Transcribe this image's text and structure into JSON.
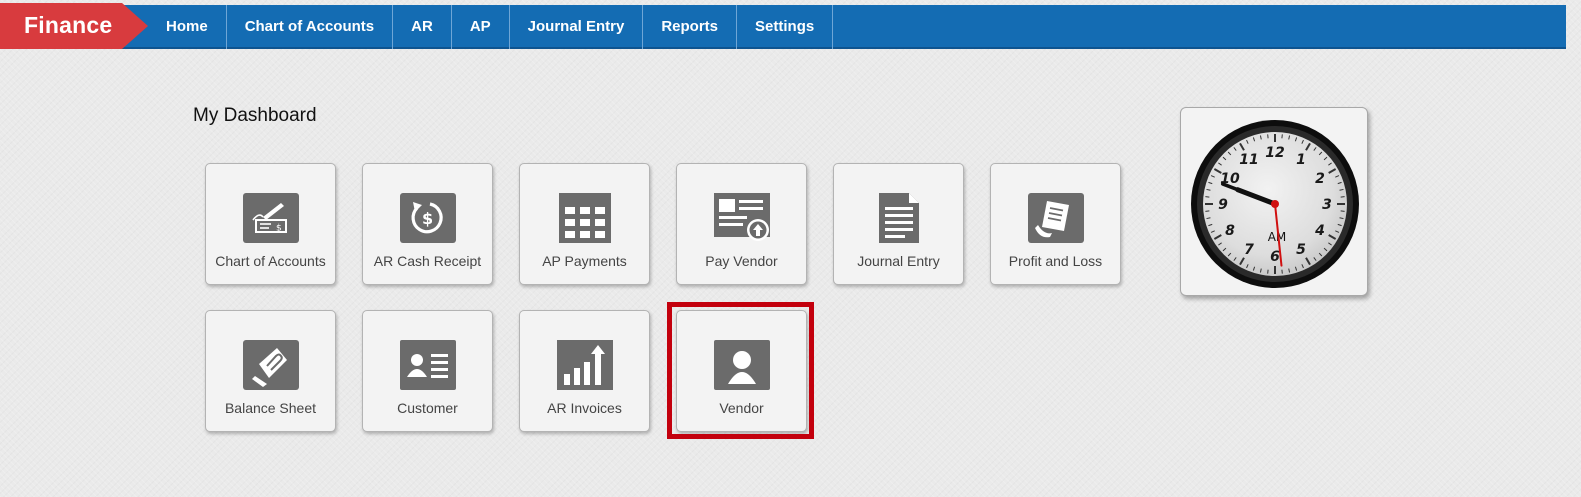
{
  "brand": "Finance",
  "nav": {
    "items": [
      {
        "label": "Home"
      },
      {
        "label": "Chart of Accounts"
      },
      {
        "label": "AR"
      },
      {
        "label": "AP"
      },
      {
        "label": "Journal Entry"
      },
      {
        "label": "Reports"
      },
      {
        "label": "Settings"
      }
    ]
  },
  "dashboard": {
    "title": "My Dashboard",
    "tiles": [
      {
        "label": "Chart of Accounts",
        "icon": "check-icon"
      },
      {
        "label": "AR Cash Receipt",
        "icon": "cash-refund-icon"
      },
      {
        "label": "AP Payments",
        "icon": "calculator-grid-icon"
      },
      {
        "label": "Pay Vendor",
        "icon": "pay-upload-icon"
      },
      {
        "label": "Journal Entry",
        "icon": "document-icon"
      },
      {
        "label": "Profit and Loss",
        "icon": "receipt-icon"
      },
      {
        "label": "Balance Sheet",
        "icon": "paper-clip-icon"
      },
      {
        "label": "Customer",
        "icon": "contact-card-icon"
      },
      {
        "label": "AR Invoices",
        "icon": "bar-growth-icon"
      },
      {
        "label": "Vendor",
        "icon": "person-icon"
      }
    ],
    "highlighted_tile": "Vendor"
  },
  "clock": {
    "period": "AM",
    "numerals": [
      "12",
      "1",
      "2",
      "3",
      "4",
      "5",
      "6",
      "7",
      "8",
      "9",
      "10",
      "11"
    ],
    "hands": {
      "hour": 9.7,
      "minute": 48.5,
      "second": 29
    },
    "colors": {
      "second_hand": "#d01010",
      "bezel": "#111111",
      "face": "#e4e4e4"
    }
  },
  "colors": {
    "nav_bg": "#146cb3",
    "brand_bg": "#d83b3e",
    "icon": "#6b6b6b",
    "highlight": "#c3000d"
  }
}
